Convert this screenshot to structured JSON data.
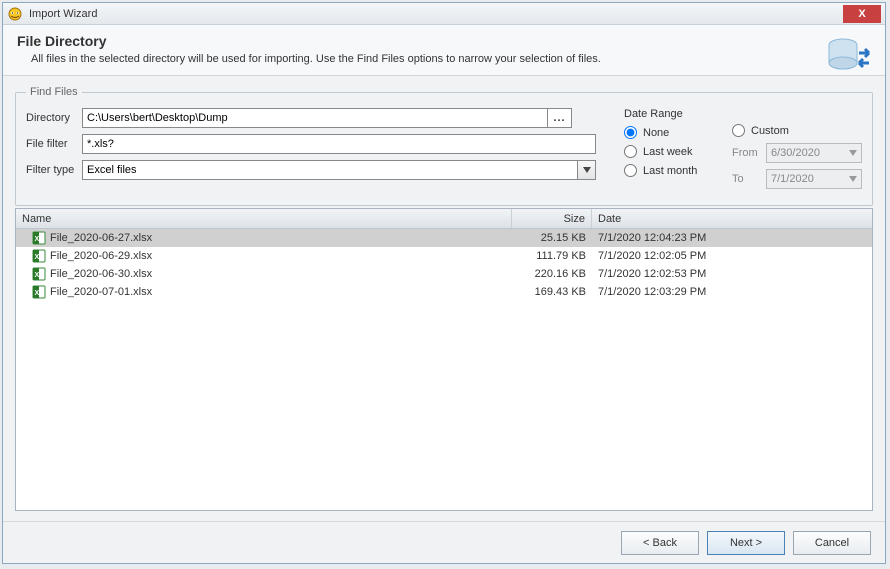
{
  "window": {
    "title": "Import Wizard",
    "close_label": "X"
  },
  "header": {
    "title": "File Directory",
    "subtitle": "All files in the selected directory will be used for importing.  Use the Find Files options to narrow your selection of files."
  },
  "find_files": {
    "legend": "Find Files",
    "directory_label": "Directory",
    "directory_value": "C:\\Users\\bert\\Desktop\\Dump",
    "browse_label": "...",
    "file_filter_label": "File filter",
    "file_filter_value": "*.xls?",
    "filter_type_label": "Filter type",
    "filter_type_value": "Excel files"
  },
  "date_range": {
    "title": "Date Range",
    "none_label": "None",
    "last_week_label": "Last week",
    "last_month_label": "Last month",
    "custom_label": "Custom",
    "from_label": "From",
    "to_label": "To",
    "from_value": "6/30/2020",
    "to_value": "7/1/2020"
  },
  "columns": {
    "name": "Name",
    "size": "Size",
    "date": "Date"
  },
  "files": [
    {
      "name": "File_2020-06-27.xlsx",
      "size": "25.15 KB",
      "date": "7/1/2020 12:04:23 PM",
      "selected": true
    },
    {
      "name": "File_2020-06-29.xlsx",
      "size": "111.79 KB",
      "date": "7/1/2020 12:02:05 PM",
      "selected": false
    },
    {
      "name": "File_2020-06-30.xlsx",
      "size": "220.16 KB",
      "date": "7/1/2020 12:02:53 PM",
      "selected": false
    },
    {
      "name": "File_2020-07-01.xlsx",
      "size": "169.43 KB",
      "date": "7/1/2020 12:03:29 PM",
      "selected": false
    }
  ],
  "buttons": {
    "back": "< Back",
    "next": "Next >",
    "cancel": "Cancel"
  }
}
